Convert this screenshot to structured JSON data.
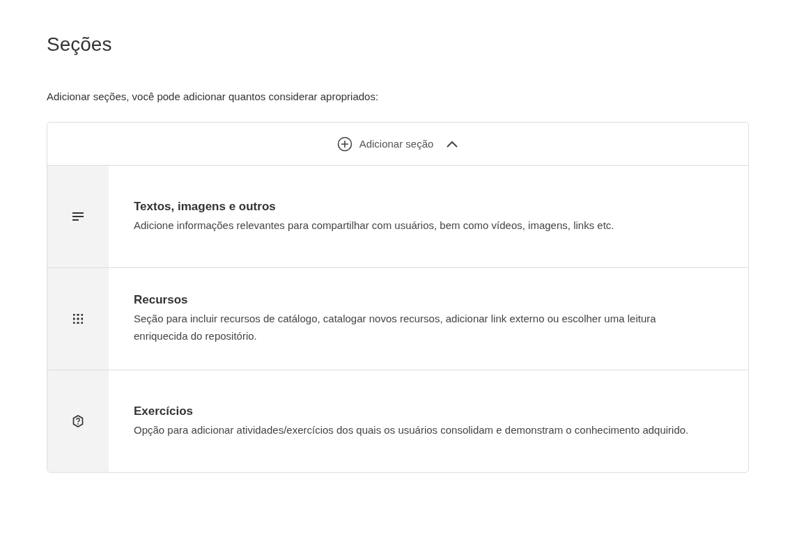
{
  "title": "Seções",
  "intro": "Adicionar seções, você pode adicionar quantos considerar apropriados:",
  "add_section": {
    "label": "Adicionar seção",
    "expanded": true
  },
  "options": [
    {
      "kind": "text",
      "title": "Textos, imagens e outros",
      "description": "Adicione informações relevantes para compartilhar com usuários, bem como vídeos, imagens, links etc."
    },
    {
      "kind": "resources",
      "title": "Recursos",
      "description": "Seção para incluir recursos de catálogo, catalogar novos recursos, adicionar link externo ou escolher uma leitura enriquecida do repositório."
    },
    {
      "kind": "exercises",
      "title": "Exercícios",
      "description": "Opção para adicionar atividades/exercícios dos quais os usuários consolidam e demonstram o conhecimento adquirido."
    }
  ]
}
